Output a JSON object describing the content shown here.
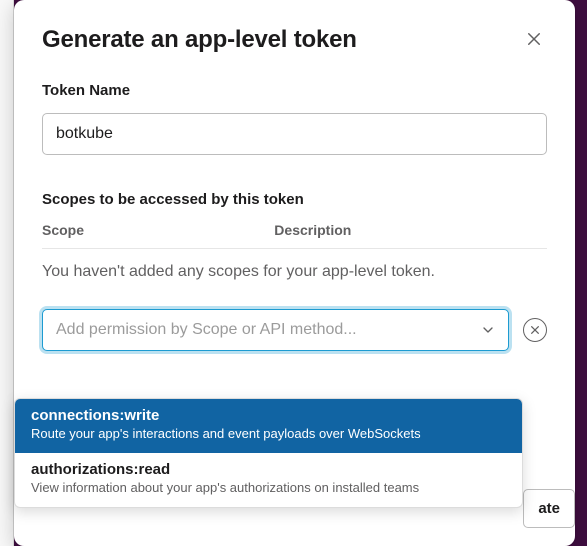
{
  "modal": {
    "title": "Generate an app-level token",
    "token_name_label": "Token Name",
    "token_name_value": "botkube",
    "scopes_label": "Scopes to be accessed by this token",
    "col_scope": "Scope",
    "col_description": "Description",
    "empty_scopes_msg": "You haven't added any scopes for your app-level token.",
    "combo_placeholder": "Add permission by Scope or API method...",
    "generate_label": "ate"
  },
  "dropdown": {
    "options": [
      {
        "name": "connections:write",
        "desc": "Route your app's interactions and event payloads over WebSockets",
        "selected": true
      },
      {
        "name": "authorizations:read",
        "desc": "View information about your app's authorizations on installed teams",
        "selected": false
      }
    ]
  }
}
